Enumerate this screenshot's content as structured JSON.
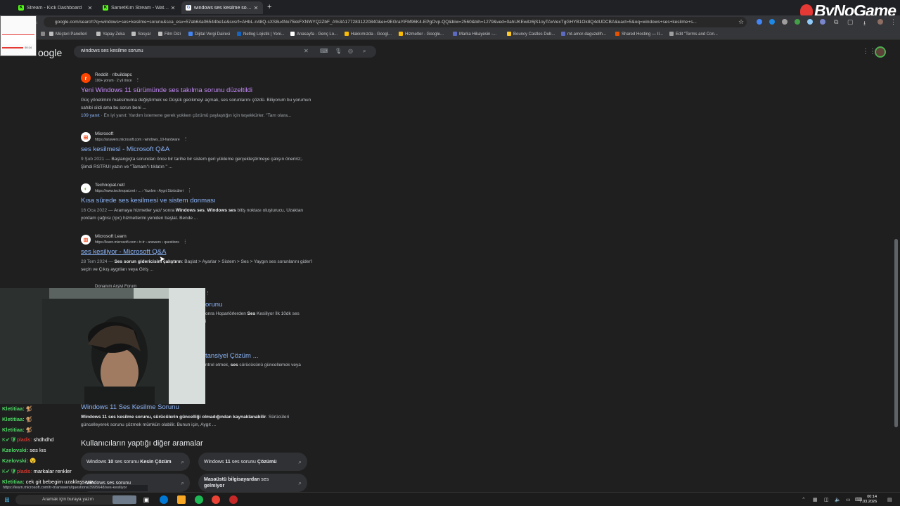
{
  "tabs": [
    {
      "label": "Stream - Kick Dashboard",
      "icon": "kick-icon",
      "icon_glyph": "K",
      "color": "#53fc18"
    },
    {
      "label": "SametKim Stream - Watch Live",
      "icon": "kick-icon",
      "icon_glyph": "K",
      "color": "#53fc18"
    },
    {
      "label": "windows ses kesilme sorunu - G",
      "icon": "google-icon",
      "icon_glyph": "G",
      "color": "#ffffff"
    }
  ],
  "brand": "ByNoGame",
  "url": "google.com/search?q=windows+ses+kesilme+sorunu&sca_esv=57ab64a06544be1e&sxsrf=AHbL-n48Q-sXS8u4No75kkFXNWYQ2ZbF_A%3A1772831220840&ei=9EGraYiFM96K4-EPgOvp-QQ&biw=2560&bih=1279&ved=0ahUKEwiIz6jS1oyTAxVexTgGHYB1Ok8Q4dUDCBA&uact=5&oq=windows+ses+kesilme+s...",
  "bookmarks": [
    "Müşteri Panelleri",
    "Yapay Zeka",
    "Sosyal",
    "Film Dizi",
    "Dijital Vergi Dairesi",
    "Netlog Lojistik | Yeni...",
    "Anasayfa - Genç Lo...",
    "Hakkımızda - Googl...",
    "Hizmetler - Google...",
    "Marka Hikayesin -...",
    "Bouncy Castles Dub...",
    "mt-amor-daguzellh...",
    "Shared Hosting — II...",
    "Edit \"Terms and Con..."
  ],
  "logo": "oogle",
  "search": {
    "query": "windows ses kesilme sorunu"
  },
  "results": [
    {
      "site": "Reddit · r/buildapc",
      "url": "100+ yorum · 2 yıl önce",
      "title": "Yeni Windows 11 sürümünde ses takılma sorunu düzeltildi",
      "snippet": "Güç yönetimini maksimuma değiştirmek ve Düşük gecikmeyi açmak, ses sorunlarını çözdü. Biliyorum bu yorumun sahibi sildi ama bu sorun beni ...",
      "note_link": "109 yanıt",
      "note": " · En iyi yanıt: Yardım istemene gerek yokken çözümü paylaştığın için teşekkürler. \"Tam olara...",
      "icon": "reddit-icon",
      "icon_glyph": "r",
      "icon_color": "#ff4500"
    },
    {
      "site": "Microsoft",
      "url": "https://answers.microsoft.com › windows_10-hardware",
      "title": "ses kesilmesi - Microsoft Q&A",
      "date": "9 Şub 2021",
      "snippet": "Başlangıçta sorundan önce bir tarihe bir sistem geri yükleme gerçekleştirmeye çalışın öneririz;. Şimdi RSTRUI yazın ve \"Tamam\"ı tıklatın \" ...",
      "icon": "microsoft-icon",
      "icon_glyph": "⊞",
      "icon_color": "#f25022"
    },
    {
      "site": "Technopat.net/",
      "url": "https://www.technopat.net › ... › Yazılım › Aygıt Sürücüleri",
      "title": "Kısa sürede ses kesilmesi ve sistem donması",
      "date": "16 Oca 2022",
      "snippet_pre": "Aramaya hizmetler yaz/ sonra ",
      "snippet_b1": "Windows ses",
      "snippet_mid": ", ",
      "snippet_b2": "Windows ses",
      "snippet_post": " bitiş noktası oluşturucu, Uzaktan yordam çağrısı (rpc) hizmetlerini yeniden başlat. Bende ...",
      "icon": "technopat-icon",
      "icon_glyph": "◐",
      "icon_color": "#8bc34a"
    },
    {
      "site": "Microsoft Learn",
      "url": "https://learn.microsoft.com › tr-tr › answers › questions",
      "title": "ses kesiliyor - Microsoft Q&A",
      "date": "28 Tem 2024",
      "snippet_b1": "Ses sorun gidericisini çalıştırın",
      "snippet_post": ": Başlat > Ayarlar > Sistem > Ses > Yaygın ses sorunlarını gider'i seçin ve Çıkış aygıtları veya Giriş ...",
      "icon": "microsoft-learn-icon",
      "icon_glyph": "⊞",
      "icon_color": "#f25022"
    }
  ],
  "hidden_fragments": {
    "site": "Donanım Arşivi Forum",
    "title_tail": "orunu",
    "snippet_frag": "onra Hoparlörlerden ",
    "snippet_b": "Ses",
    "snippet_tail": " Kesiliyor İlk 10dk ses",
    "snippet_tail2": "i",
    "title2_tail": "tansiyel Çözüm ...",
    "snippet2_frag": "ntrol etmek, ",
    "snippet2_b": "ses",
    "snippet2_tail": " sürücüsünü güncellemek veya"
  },
  "result5": {
    "title": "Windows 11 Ses Kesilme Sorunu",
    "snippet_b1": "Windows 11 ses kesilme sorunu, sürücülerin güncelliği olmadığından kaynaklanabilir",
    "snippet_post": ". Sürücüleri güncelleyerek sorunu çözmek mümkün olabilir. Bunun için, Aygıt ..."
  },
  "related": {
    "heading": "Kullanıcıların yaptığı diğer aramalar",
    "chips": [
      {
        "pre": "Windows ",
        "b": "10",
        "post": " ses sorunu ",
        "b2": "Kesin Çözüm"
      },
      {
        "pre": "Windows ",
        "b": "11",
        "post": " ses sorunu ",
        "b2": "Çözümü"
      },
      {
        "pre": "windows ses sorunu",
        "b": "",
        "post": "",
        "b2": ""
      },
      {
        "pre": "",
        "b": "Masaüstü bilgisayardan",
        "post": " ses ",
        "b2": "gelmiyor"
      }
    ]
  },
  "chat": [
    {
      "user": "Kletitiaa:",
      "msg": "🐒",
      "badge": ""
    },
    {
      "user": "Kletitiaa:",
      "msg": "🐒",
      "badge": ""
    },
    {
      "user": "Kletitiaa:",
      "msg": "🐒",
      "badge": ""
    },
    {
      "user": "pladis:",
      "msg": "shdhdhd",
      "badge": "K✔🛡"
    },
    {
      "user": "Kzelovski:",
      "msg": "ses kıs",
      "badge": ""
    },
    {
      "user": "Kzelovski:",
      "msg": "😵",
      "badge": ""
    },
    {
      "user": "pladis:",
      "msg": "markalar renkler",
      "badge": "K✔🛡"
    },
    {
      "user": "Kletitiaa:",
      "msg": "cek git bebegim uzaklaşsana",
      "badge": ""
    }
  ],
  "status_url": "https://learn.microsoft.com/tr-tr/answers/questions/3995648/ses-kesiliyor",
  "taskbar": {
    "search_placeholder": "Aramak için buraya yazın",
    "time": "00:14",
    "date": "7.03.2026"
  },
  "preview_timer": "00:14"
}
